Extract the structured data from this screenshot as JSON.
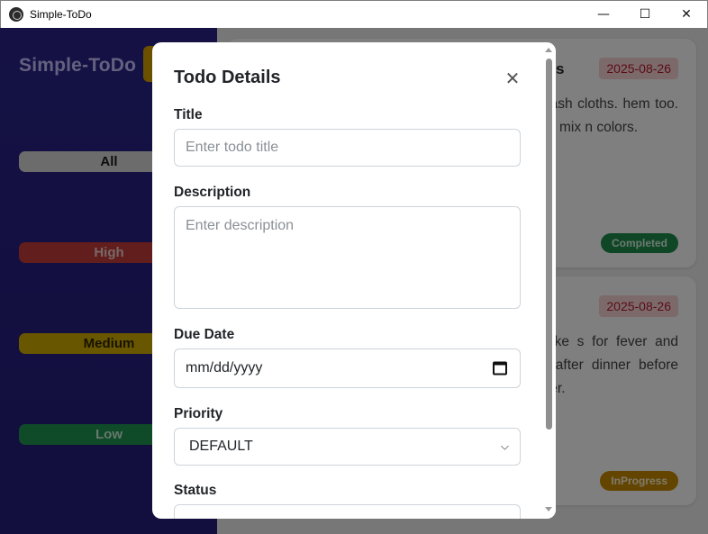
{
  "window": {
    "title": "Simple-ToDo",
    "minimize": "—",
    "maximize": "☐",
    "close": "✕"
  },
  "sidebar": {
    "brand": "Simple-ToDo",
    "filters": [
      {
        "label": "All"
      },
      {
        "label": "High"
      },
      {
        "label": "Medium"
      },
      {
        "label": "Low"
      }
    ]
  },
  "cards": [
    {
      "title_visible": "ths",
      "date": "2025-08-26",
      "description_visible": "to wash cloths. hem too. Don't mix n colors.",
      "status": "Completed"
    },
    {
      "title_visible": "s",
      "date": "2025-08-26",
      "description_visible": "to take s for fever and pills after dinner before dinner.",
      "status": "InProgress"
    }
  ],
  "modal": {
    "title": "Todo Details",
    "close_glyph": "✕",
    "fields": {
      "title_label": "Title",
      "title_placeholder": "Enter todo title",
      "description_label": "Description",
      "description_placeholder": "Enter description",
      "due_label": "Due Date",
      "due_placeholder": "mm/dd/yyyy",
      "priority_label": "Priority",
      "priority_value": "DEFAULT",
      "status_label": "Status"
    }
  },
  "colors": {
    "sidebar": "#2a238a",
    "filter_all": "#d9d9d9",
    "filter_high": "#c43a3a",
    "filter_medium": "#d3ad00",
    "filter_low": "#1f9650",
    "date_badge_bg": "#f8d4d6",
    "completed": "#1e8f4d",
    "inprogress": "#c98a00"
  },
  "icons": {
    "app": "electron-logo-icon",
    "calendar": "calendar-icon",
    "select_caret": "chevron-down-icon"
  }
}
